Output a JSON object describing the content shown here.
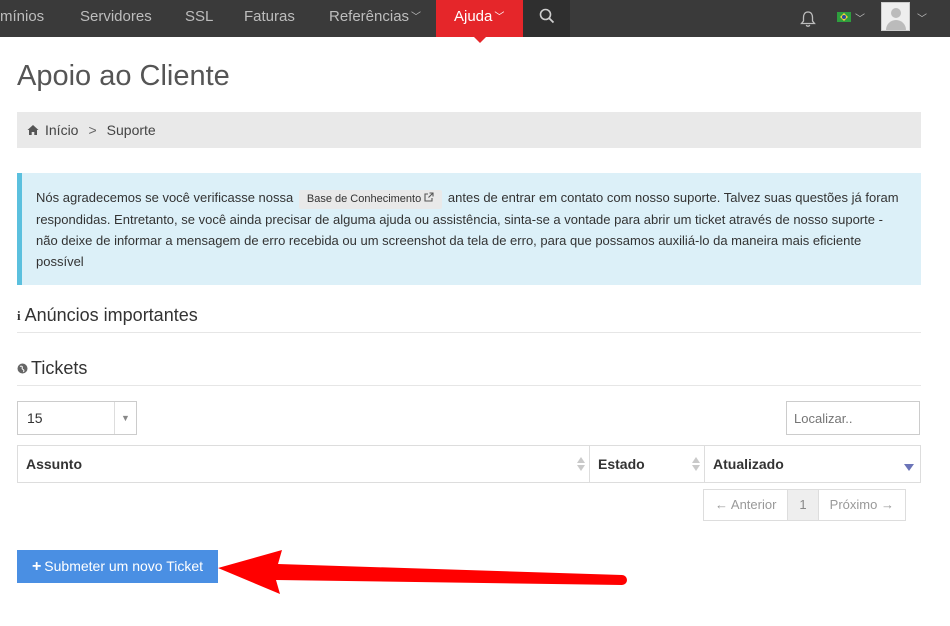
{
  "nav": {
    "items": [
      {
        "label": "mínios"
      },
      {
        "label": "Servidores"
      },
      {
        "label": "SSL"
      },
      {
        "label": "Faturas"
      },
      {
        "label": "Referências"
      },
      {
        "label": "Ajuda"
      }
    ],
    "active_color": "#e5262a"
  },
  "page": {
    "title": "Apoio ao Cliente"
  },
  "breadcrumb": {
    "home": "Início",
    "current": "Suporte"
  },
  "info": {
    "text_before": "Nós agradecemos se você verificasse nossa",
    "kb_label": "Base de Conhecimento",
    "text_after": "antes de entrar em contato com nosso suporte. Talvez suas questões já foram respondidas. Entretanto, se você ainda precisar de alguma ajuda ou assistência, sinta-se a vontade para abrir um ticket através de nosso suporte - não deixe de informar a mensagem de erro recebida ou um screenshot da tela de erro, para que possamos auxiliá-lo da maneira mais eficiente possível"
  },
  "announcements": {
    "title": "Anúncios importantes"
  },
  "tickets": {
    "title": "Tickets",
    "page_size": "15",
    "search_placeholder": "Localizar..",
    "columns": [
      "Assunto",
      "Estado",
      "Atualizado"
    ],
    "pager": {
      "prev": "← Anterior",
      "page": "1",
      "next": "Próximo →"
    },
    "submit_label": "Submeter um novo Ticket"
  },
  "colors": {
    "accent": "#e5262a",
    "primary_button": "#4a8fe3",
    "info_bg": "#dcf0f8",
    "info_border": "#5bc0de",
    "annotation_arrow": "#ff0000"
  }
}
